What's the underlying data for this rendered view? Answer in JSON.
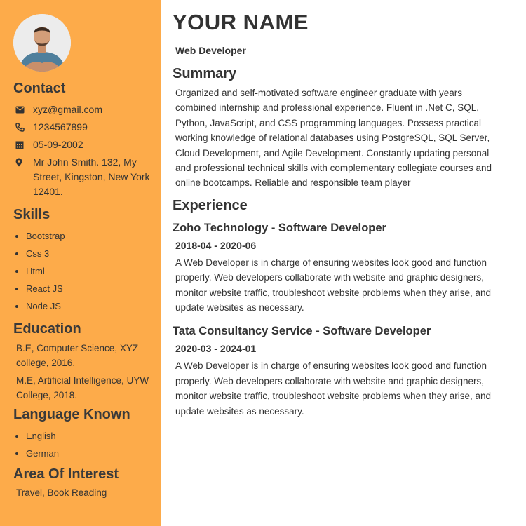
{
  "contact": {
    "heading": "Contact",
    "email": "xyz@gmail.com",
    "phone": "1234567899",
    "dob": "05-09-2002",
    "address": "Mr John Smith. 132, My Street, Kingston, New York 12401."
  },
  "skills": {
    "heading": "Skills",
    "items": [
      "Bootstrap",
      "Css 3",
      "Html",
      "React JS",
      "Node JS"
    ]
  },
  "education": {
    "heading": "Education",
    "items": [
      "B.E, Computer Science, XYZ college, 2016.",
      "M.E, Artificial Intelligence, UYW College, 2018."
    ]
  },
  "languages": {
    "heading": "Language Known",
    "items": [
      "English",
      "German"
    ]
  },
  "interest": {
    "heading": "Area Of Interest",
    "text": "Travel, Book Reading"
  },
  "header": {
    "name": "YOUR NAME",
    "role": "Web Developer"
  },
  "summary": {
    "heading": "Summary",
    "text": "Organized and self-motivated software engineer graduate with years combined internship and professional experience. Fluent in .Net C, SQL, Python, JavaScript, and CSS programming languages. Possess practical working knowledge of relational databases using PostgreSQL, SQL Server, Cloud Development, and Agile Development. Constantly updating personal and professional technical skills with complementary collegiate courses and online bootcamps. Reliable and responsible team player"
  },
  "experience": {
    "heading": "Experience",
    "jobs": [
      {
        "title": "Zoho Technology - Software Developer",
        "dates": "2018-04 - 2020-06",
        "description": "A Web Developer is in charge of ensuring websites look good and function properly. Web developers collaborate with website and graphic designers, monitor website traffic, troubleshoot website problems when they arise, and update websites as necessary."
      },
      {
        "title": "Tata Consultancy Service - Software Developer",
        "dates": "2020-03 - 2024-01",
        "description": "A Web Developer is in charge of ensuring websites look good and function properly. Web developers collaborate with website and graphic designers, monitor website traffic, troubleshoot website problems when they arise, and update websites as necessary."
      }
    ]
  },
  "icons": {
    "email": "envelope-icon",
    "phone": "phone-icon",
    "dob": "calendar-icon",
    "address": "map-pin-icon"
  },
  "colors": {
    "sidebar": "#fdab4a",
    "text": "#333333"
  }
}
